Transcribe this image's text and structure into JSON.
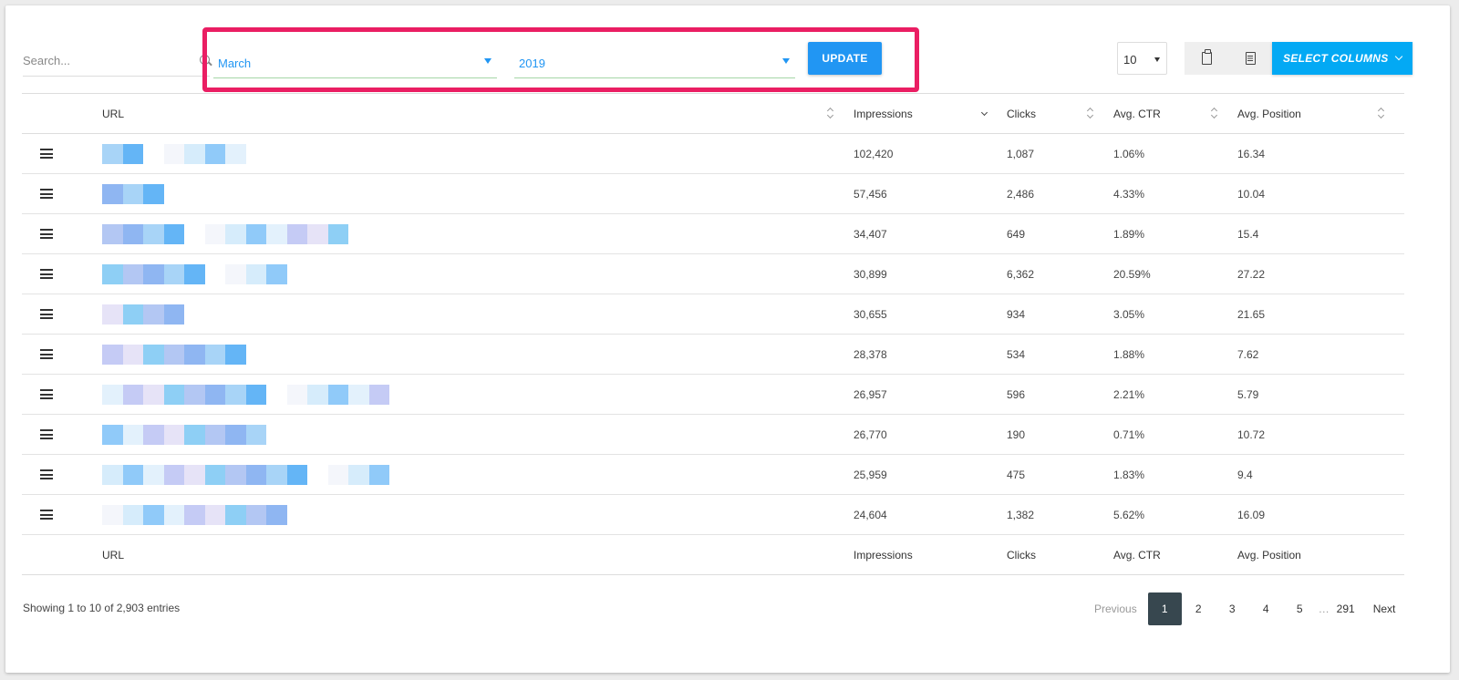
{
  "search": {
    "placeholder": "Search..."
  },
  "filters": {
    "month": "March",
    "year": "2019",
    "update_label": "UPDATE"
  },
  "page_length": "10",
  "buttons": {
    "copy_icon": "clipboard-icon",
    "csv_icon": "csv-icon",
    "select_columns": "SELECT COLUMNS"
  },
  "columns": {
    "url": "URL",
    "impressions": "Impressions",
    "clicks": "Clicks",
    "ctr": "Avg. CTR",
    "position": "Avg. Position"
  },
  "rows": [
    {
      "impressions": "102,420",
      "clicks": "1,087",
      "ctr": "1.06%",
      "position": "16.34"
    },
    {
      "impressions": "57,456",
      "clicks": "2,486",
      "ctr": "4.33%",
      "position": "10.04"
    },
    {
      "impressions": "34,407",
      "clicks": "649",
      "ctr": "1.89%",
      "position": "15.4"
    },
    {
      "impressions": "30,899",
      "clicks": "6,362",
      "ctr": "20.59%",
      "position": "27.22"
    },
    {
      "impressions": "30,655",
      "clicks": "934",
      "ctr": "3.05%",
      "position": "21.65"
    },
    {
      "impressions": "28,378",
      "clicks": "534",
      "ctr": "1.88%",
      "position": "7.62"
    },
    {
      "impressions": "26,957",
      "clicks": "596",
      "ctr": "2.21%",
      "position": "5.79"
    },
    {
      "impressions": "26,770",
      "clicks": "190",
      "ctr": "0.71%",
      "position": "10.72"
    },
    {
      "impressions": "25,959",
      "clicks": "475",
      "ctr": "1.83%",
      "position": "9.4"
    },
    {
      "impressions": "24,604",
      "clicks": "1,382",
      "ctr": "5.62%",
      "position": "16.09"
    }
  ],
  "info": "Showing 1 to 10 of 2,903 entries",
  "pagination": {
    "previous": "Previous",
    "pages": [
      "1",
      "2",
      "3",
      "4",
      "5"
    ],
    "ellipsis": "…",
    "last": "291",
    "next": "Next"
  },
  "colors": {
    "highlight": "#ea1e63",
    "primary": "#2196f3",
    "select_columns": "#03a9f4",
    "active_page": "#37474f"
  }
}
